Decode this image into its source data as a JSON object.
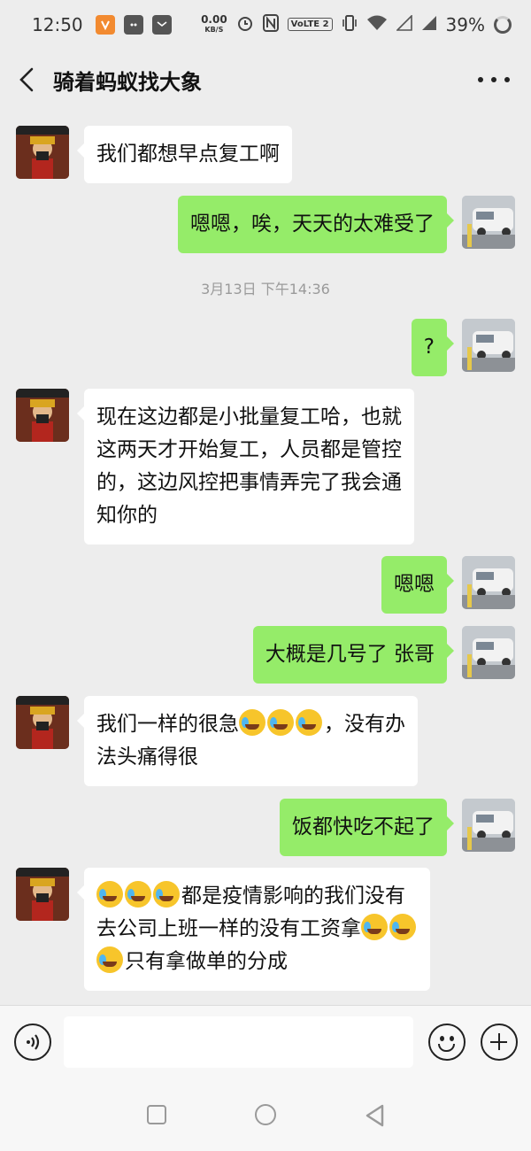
{
  "status_bar": {
    "time": "12:50",
    "net_speed_value": "0.00",
    "net_speed_unit": "KB/S",
    "volte_label": "VoLTE 2",
    "battery_percent": "39%"
  },
  "header": {
    "title": "骑着蚂蚁找大象"
  },
  "messages": [
    {
      "side": "left",
      "text": "我们都想早点复工啊"
    },
    {
      "side": "right",
      "text": "嗯嗯，唉，天天的太难受了"
    },
    {
      "side": "right",
      "text": "?"
    },
    {
      "side": "left",
      "lines": [
        "现在这边都是小批量复工哈，也就",
        "这两天才开始复工，人员都是管控",
        "的，这边风控把事情弄完了我会通",
        "知你的"
      ]
    },
    {
      "side": "right",
      "text": "嗯嗯"
    },
    {
      "side": "right",
      "text": "大概是几号了 张哥"
    },
    {
      "side": "left",
      "line1_before": "我们一样的很急",
      "line1_after": "，没有办",
      "line2": "法头痛得很"
    },
    {
      "side": "right",
      "text": "饭都快吃不起了"
    },
    {
      "side": "left",
      "line1_after": "都是疫情影响的我们没有",
      "line2_before": "去公司上班一样的没有工资拿",
      "line3_after": "只有拿做单的分成"
    }
  ],
  "timestamp": "3月13日 下午14:36",
  "input_bar": {
    "placeholder": ""
  },
  "icons": {
    "back": "chevron-left-icon",
    "more": "more-dots-icon",
    "voice": "voice-icon",
    "emoji": "smiley-icon",
    "plus": "plus-icon",
    "sticker": "crying-laughing-emoji"
  },
  "colors": {
    "background": "#ededed",
    "bubble_sent": "#95ec69",
    "bubble_received": "#ffffff",
    "timestamp_text": "#9a9a9a"
  }
}
